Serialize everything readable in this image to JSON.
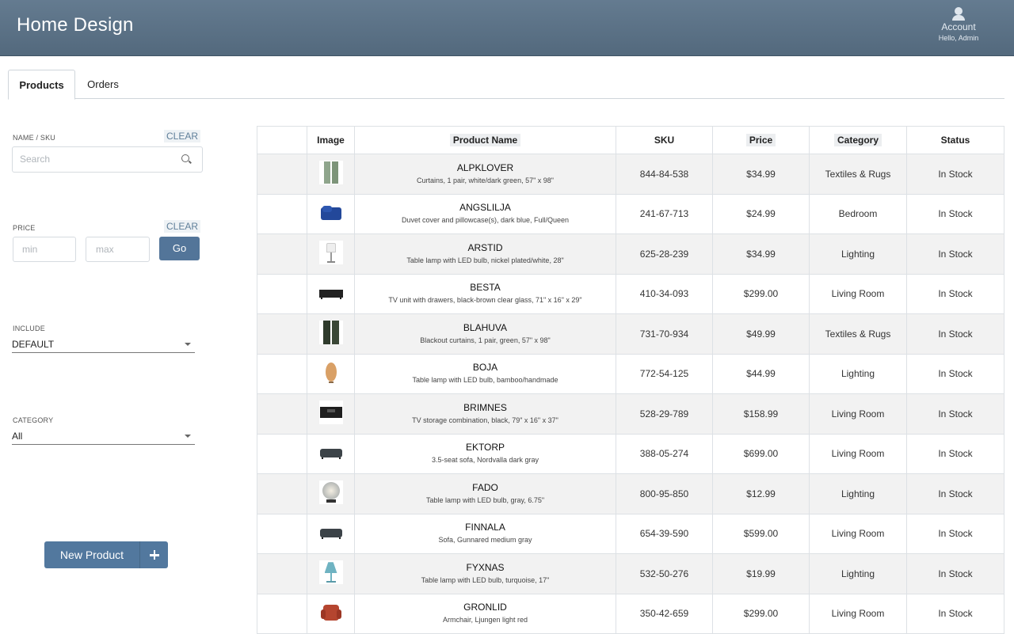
{
  "header": {
    "brand": "Home Design",
    "account_label": "Account",
    "greeting": "Hello, Admin"
  },
  "tabs": [
    {
      "label": "Products",
      "active": true
    },
    {
      "label": "Orders",
      "active": false
    }
  ],
  "filters": {
    "name_sku": {
      "label": "NAME / SKU",
      "clear": "CLEAR",
      "placeholder": "Search"
    },
    "price": {
      "label": "PRICE",
      "clear": "CLEAR",
      "min_placeholder": "min",
      "max_placeholder": "max",
      "go": "Go"
    },
    "include": {
      "label": "INCLUDE",
      "value": "DEFAULT"
    },
    "category": {
      "label": "CATEGORY",
      "value": "All"
    }
  },
  "new_product": {
    "label": "New Product"
  },
  "table": {
    "columns": [
      "",
      "Image",
      "Product Name",
      "SKU",
      "Price",
      "Category",
      "Status"
    ],
    "rows": [
      {
        "name": "ALPKLOVER",
        "desc": "Curtains, 1 pair, white/dark green, 57\" x 98\"",
        "sku": "844-84-538",
        "price": "$34.99",
        "category": "Textiles & Rugs",
        "status": "In Stock",
        "icon": "curtains-icon"
      },
      {
        "name": "ANGSLILJA",
        "desc": "Duvet cover and pillowcase(s), dark blue, Full/Queen",
        "sku": "241-67-713",
        "price": "$24.99",
        "category": "Bedroom",
        "status": "In Stock",
        "icon": "duvet-icon"
      },
      {
        "name": "ARSTID",
        "desc": "Table lamp with LED bulb, nickel plated/white, 28\"",
        "sku": "625-28-239",
        "price": "$34.99",
        "category": "Lighting",
        "status": "In Stock",
        "icon": "table-lamp-icon"
      },
      {
        "name": "BESTA",
        "desc": "TV unit with drawers, black-brown clear glass, 71\" x 16\" x 29\"",
        "sku": "410-34-093",
        "price": "$299.00",
        "category": "Living Room",
        "status": "In Stock",
        "icon": "tv-unit-icon"
      },
      {
        "name": "BLAHUVA",
        "desc": "Blackout curtains, 1 pair, green, 57\" x 98\"",
        "sku": "731-70-934",
        "price": "$49.99",
        "category": "Textiles & Rugs",
        "status": "In Stock",
        "icon": "curtains-icon"
      },
      {
        "name": "BOJA",
        "desc": "Table lamp with LED bulb, bamboo/handmade",
        "sku": "772-54-125",
        "price": "$44.99",
        "category": "Lighting",
        "status": "In Stock",
        "icon": "bamboo-lamp-icon"
      },
      {
        "name": "BRIMNES",
        "desc": "TV storage combination, black, 79\" x 16\" x 37\"",
        "sku": "528-29-789",
        "price": "$158.99",
        "category": "Living Room",
        "status": "In Stock",
        "icon": "tv-storage-icon"
      },
      {
        "name": "EKTORP",
        "desc": "3.5-seat sofa, Nordvalla dark gray",
        "sku": "388-05-274",
        "price": "$699.00",
        "category": "Living Room",
        "status": "In Stock",
        "icon": "sofa-icon"
      },
      {
        "name": "FADO",
        "desc": "Table lamp with LED bulb, gray, 6.75\"",
        "sku": "800-95-850",
        "price": "$12.99",
        "category": "Lighting",
        "status": "In Stock",
        "icon": "globe-lamp-icon"
      },
      {
        "name": "FINNALA",
        "desc": "Sofa, Gunnared medium gray",
        "sku": "654-39-590",
        "price": "$599.00",
        "category": "Living Room",
        "status": "In Stock",
        "icon": "sofa-icon"
      },
      {
        "name": "FYXNAS",
        "desc": "Table lamp with LED bulb, turquoise, 17\"",
        "sku": "532-50-276",
        "price": "$19.99",
        "category": "Lighting",
        "status": "In Stock",
        "icon": "turquoise-lamp-icon"
      },
      {
        "name": "GRONLID",
        "desc": "Armchair, Ljungen light red",
        "sku": "350-42-659",
        "price": "$299.00",
        "category": "Living Room",
        "status": "In Stock",
        "icon": "armchair-icon"
      }
    ]
  },
  "colors": {
    "header": "#5a7085",
    "accent": "#537599",
    "in_stock": "#2ecc71"
  }
}
